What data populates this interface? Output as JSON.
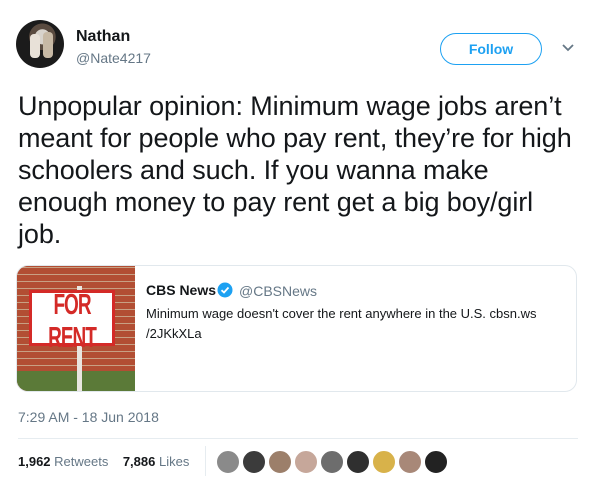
{
  "user": {
    "name": "Nathan",
    "handle": "@Nate4217"
  },
  "follow_label": "Follow",
  "tweet_text": "Unpopular opinion: Minimum wage jobs aren’t meant for people who pay rent, they’re for high schoolers and such. If you wanna make enough money to pay rent get a big boy/girl job.",
  "card": {
    "name": "CBS News",
    "handle": "@CBSNews",
    "text": "Minimum wage doesn't cover the rent anywhere in the U.S. cbsn.ws /2JKkXLa",
    "image_sign_text": "FOR RENT"
  },
  "timestamp": "7:29 AM - 18 Jun 2018",
  "stats": {
    "retweets": "1,962",
    "retweets_label": "Retweets",
    "likes": "7,886",
    "likes_label": "Likes"
  },
  "colors": {
    "accent": "#1da1f2",
    "secondary_text": "#657786",
    "border": "#e1e8ed"
  },
  "likers": [
    {
      "color": "#8a8a8a"
    },
    {
      "color": "#3b3b3b"
    },
    {
      "color": "#9c7f6a"
    },
    {
      "color": "#c6a79a"
    },
    {
      "color": "#6d6d6d"
    },
    {
      "color": "#2f2f2f"
    },
    {
      "color": "#d8b24a"
    },
    {
      "color": "#a88878"
    },
    {
      "color": "#222222"
    }
  ]
}
